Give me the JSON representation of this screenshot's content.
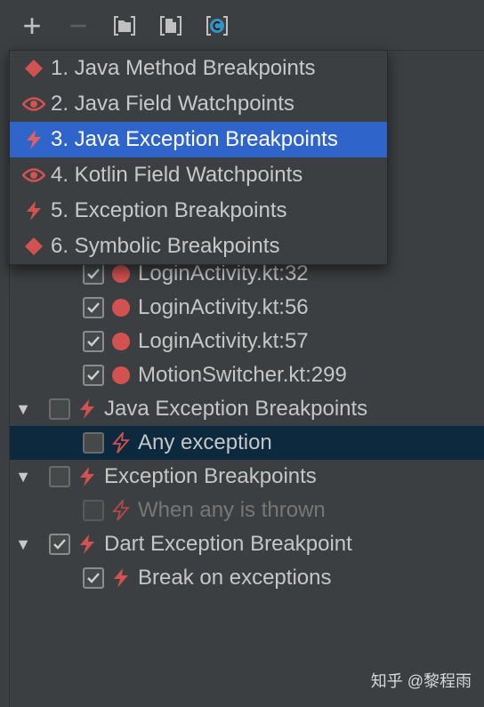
{
  "toolbar": {
    "add_label": "+",
    "remove_label": "−",
    "icons": [
      "group-by-package-icon",
      "group-by-file-icon",
      "group-by-class-icon"
    ]
  },
  "popup_menu": {
    "items": [
      {
        "label": "1. Java Method Breakpoints",
        "icon": "diamond-icon",
        "active": false
      },
      {
        "label": "2. Java Field Watchpoints",
        "icon": "eye-icon",
        "active": false
      },
      {
        "label": "3. Java Exception Breakpoints",
        "icon": "lightning-icon",
        "active": true
      },
      {
        "label": "4. Kotlin Field Watchpoints",
        "icon": "eye-icon",
        "active": false
      },
      {
        "label": "5. Exception Breakpoints",
        "icon": "lightning-icon",
        "active": false
      },
      {
        "label": "6. Symbolic Breakpoints",
        "icon": "diamond-icon",
        "active": false
      }
    ]
  },
  "tree": {
    "rows": [
      {
        "label": "LoginActivity.kt:32",
        "checked": true,
        "icon": "red-dot-icon",
        "level": 1
      },
      {
        "label": "LoginActivity.kt:56",
        "checked": true,
        "icon": "red-dot-icon",
        "level": 1
      },
      {
        "label": "LoginActivity.kt:57",
        "checked": true,
        "icon": "red-dot-icon",
        "level": 1
      },
      {
        "label": "MotionSwitcher.kt:299",
        "checked": true,
        "icon": "red-dot-icon",
        "level": 1
      },
      {
        "label": "Java Exception Breakpoints",
        "checked": false,
        "icon": "lightning-icon",
        "level": 0
      },
      {
        "label": "Any exception",
        "checked": false,
        "icon": "lightning-icon",
        "level": 1,
        "selected": true
      },
      {
        "label": "Exception Breakpoints",
        "checked": false,
        "icon": "lightning-icon",
        "level": 0
      },
      {
        "label": "When any is thrown",
        "checked": false,
        "icon": "lightning-icon",
        "level": 1,
        "dim": true
      },
      {
        "label": "Dart Exception Breakpoint",
        "checked": true,
        "icon": "lightning-icon",
        "level": 0
      },
      {
        "label": "Break on exceptions",
        "checked": true,
        "icon": "lightning-icon",
        "level": 1
      }
    ]
  },
  "watermark": "知乎 @黎程雨",
  "colors": {
    "background": "#3c3f41",
    "selection": "#2f65ca",
    "tree_selection": "#0d293e",
    "breakpoint_red": "#d25252"
  }
}
